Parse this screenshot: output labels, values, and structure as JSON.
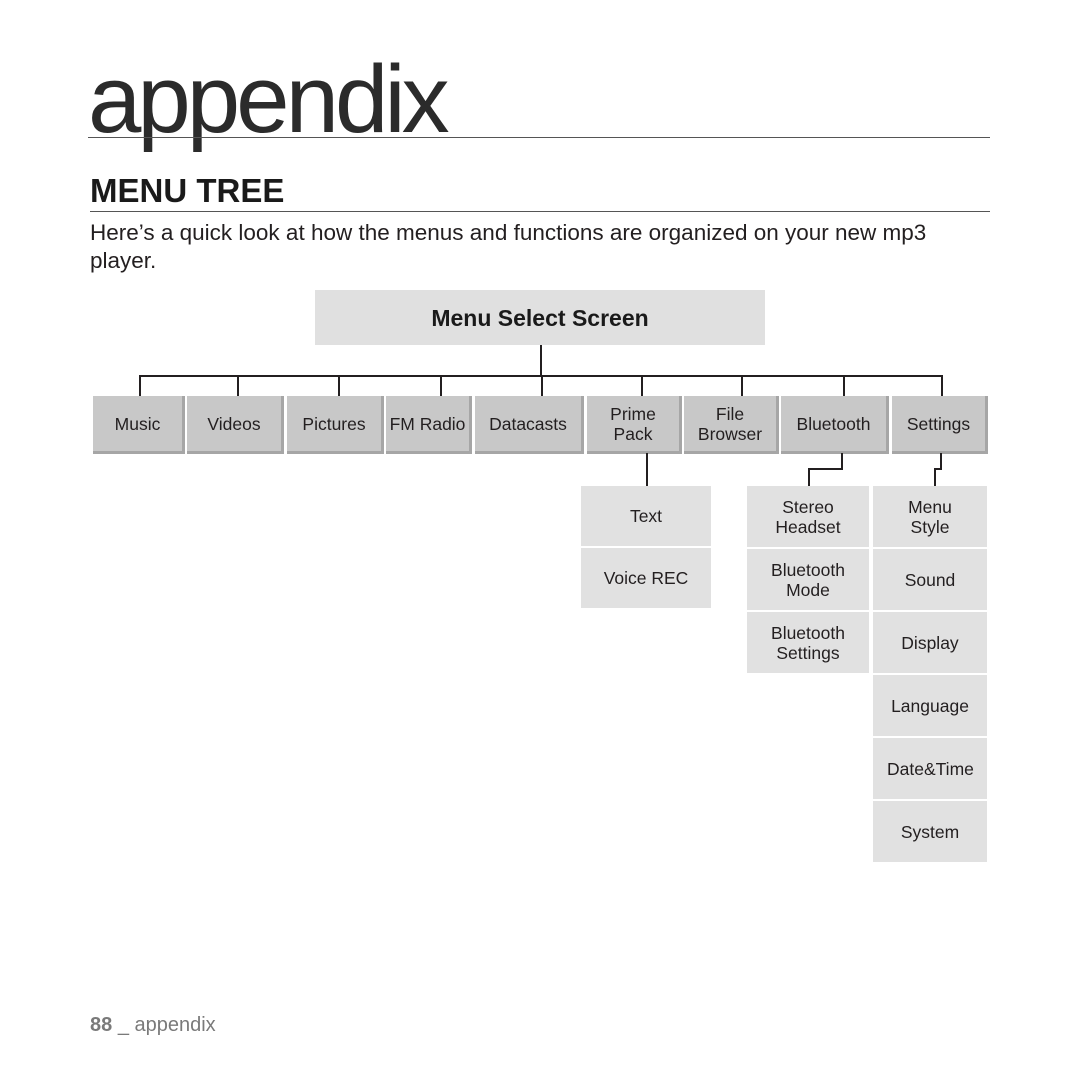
{
  "header": {
    "chapter_title": "appendix",
    "section_title": "MENU TREE",
    "intro": "Here’s a quick look at how the menus and functions are organized on your new mp3 player."
  },
  "tree": {
    "root": "Menu Select Screen",
    "top_menus": [
      {
        "label": "Music"
      },
      {
        "label": "Videos"
      },
      {
        "label": "Pictures"
      },
      {
        "label": "FM Radio"
      },
      {
        "label": "Datacasts"
      },
      {
        "label": "Prime Pack"
      },
      {
        "label": "File Browser"
      },
      {
        "label": "Bluetooth"
      },
      {
        "label": "Settings"
      }
    ],
    "prime_pack_children": [
      "Text",
      "Voice REC"
    ],
    "bluetooth_children": [
      "Stereo Headset",
      "Bluetooth Mode",
      "Bluetooth Settings"
    ],
    "settings_children": [
      "Menu Style",
      "Sound",
      "Display",
      "Language",
      "Date&Time",
      "System"
    ]
  },
  "footer": {
    "page_number": "88",
    "label": "_ appendix"
  }
}
